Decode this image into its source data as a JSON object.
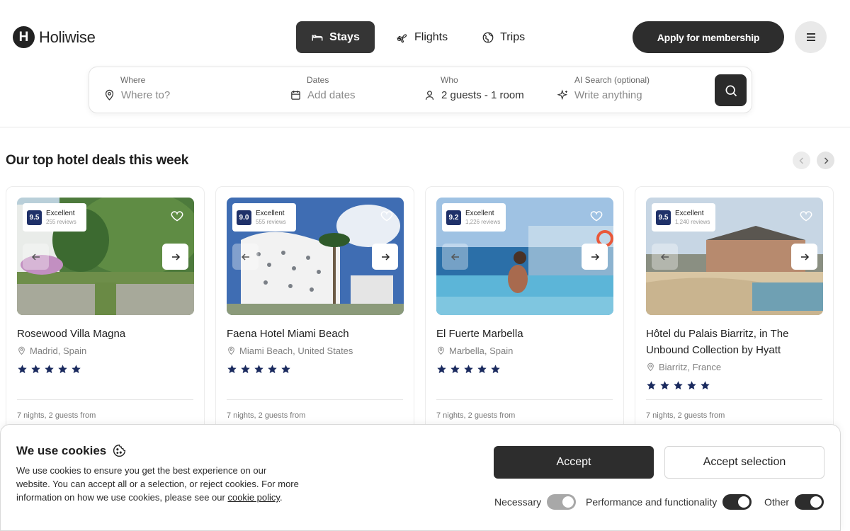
{
  "brand": {
    "name": "Holiwise",
    "mark": "H"
  },
  "nav": {
    "tabs": [
      {
        "label": "Stays",
        "icon": "bed-icon"
      },
      {
        "label": "Flights",
        "icon": "plane-icon"
      },
      {
        "label": "Trips",
        "icon": "globe-icon"
      }
    ],
    "apply_label": "Apply for membership"
  },
  "search": {
    "where": {
      "label": "Where",
      "placeholder": "Where to?"
    },
    "dates": {
      "label": "Dates",
      "placeholder": "Add dates"
    },
    "who": {
      "label": "Who",
      "value": "2 guests - 1 room"
    },
    "ai": {
      "label": "AI Search (optional)",
      "placeholder": "Write anything"
    }
  },
  "deals": {
    "title": "Our top hotel deals this week",
    "hotels": [
      {
        "name": "Rosewood Villa Magna",
        "location": "Madrid, Spain",
        "score": "9.5",
        "rating_word": "Excellent",
        "reviews": "255 reviews",
        "stars": 5,
        "price_note": "7 nights, 2 guests from"
      },
      {
        "name": "Faena Hotel Miami Beach",
        "location": "Miami Beach, United States",
        "score": "9.0",
        "rating_word": "Excellent",
        "reviews": "555 reviews",
        "stars": 5,
        "price_note": "7 nights, 2 guests from"
      },
      {
        "name": "El Fuerte Marbella",
        "location": "Marbella, Spain",
        "score": "9.2",
        "rating_word": "Excellent",
        "reviews": "1,226 reviews",
        "stars": 5,
        "price_note": "7 nights, 2 guests from"
      },
      {
        "name": "Hôtel du Palais Biarritz, in The Unbound Collection by Hyatt",
        "location": "Biarritz, France",
        "score": "9.5",
        "rating_word": "Excellent",
        "reviews": "1,240 reviews",
        "stars": 5,
        "price_note": "7 nights, 2 guests from"
      }
    ]
  },
  "cookies": {
    "title": "We use cookies",
    "body": "We use cookies to ensure you get the best experience on our website. You can accept all or a selection, or reject cookies. For more information on how we use cookies, please see our",
    "link": "cookie policy",
    "accept_label": "Accept",
    "accept_selection_label": "Accept selection",
    "toggles": [
      {
        "label": "Necessary",
        "on": true,
        "locked": true
      },
      {
        "label": "Performance and functionality",
        "on": true,
        "locked": false
      },
      {
        "label": "Other",
        "on": true,
        "locked": false
      }
    ]
  },
  "colors": {
    "primary_dark": "#2d2d2d",
    "rating_badge": "#1f3169",
    "star": "#1a2a5e"
  }
}
